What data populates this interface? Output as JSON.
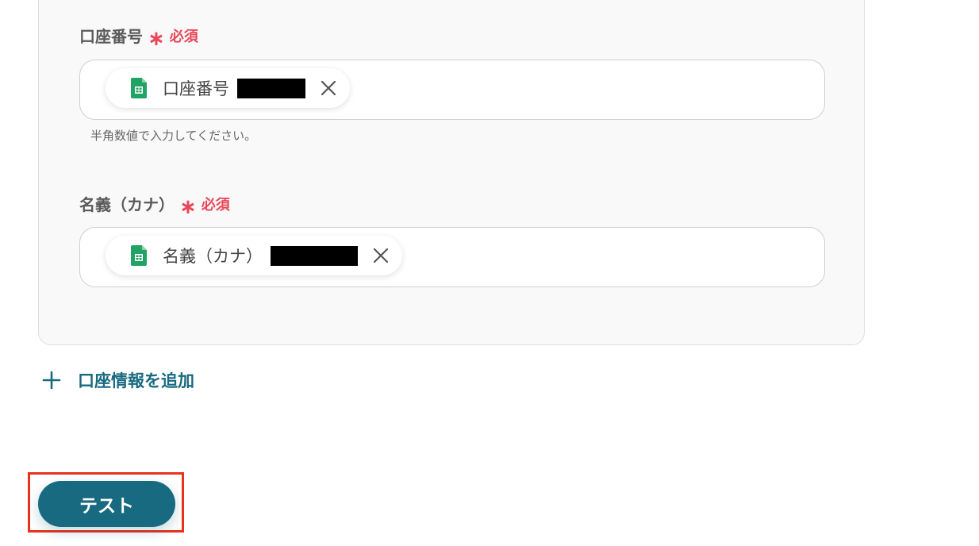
{
  "fields": [
    {
      "label": "口座番号",
      "required_text": "必須",
      "chip_label": "口座番号",
      "hint": "半角数値で入力してください。"
    },
    {
      "label": "名義（カナ）",
      "required_text": "必須",
      "chip_label": "名義（カナ）"
    }
  ],
  "required_mark": "∗",
  "add_account": {
    "icon": "plus-icon",
    "label": "口座情報を追加"
  },
  "test_button": {
    "label": "テスト"
  },
  "colors": {
    "accent": "#186a81",
    "required": "#e8495a",
    "sheets_green": "#21a366",
    "highlight_border": "#e8321c"
  },
  "icons": {
    "chip_icon": "google-sheets-icon",
    "remove_icon": "close-icon"
  }
}
